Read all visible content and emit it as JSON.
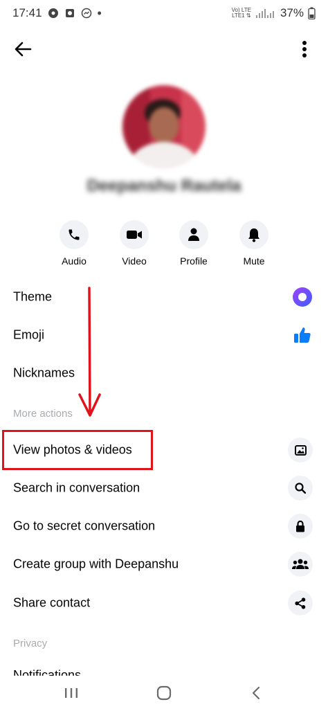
{
  "status_bar": {
    "time": "17:41",
    "network_top": "Vo) LTE",
    "network_bottom": "LTE1 ⇅",
    "battery": "37%"
  },
  "top_bar": {
    "back_icon": "arrow-left-icon",
    "more_icon": "more-vertical-icon"
  },
  "profile": {
    "name": "Deepanshu Rautela"
  },
  "quick_actions": [
    {
      "label": "Audio",
      "icon": "phone-icon"
    },
    {
      "label": "Video",
      "icon": "video-camera-icon"
    },
    {
      "label": "Profile",
      "icon": "person-icon"
    },
    {
      "label": "Mute",
      "icon": "bell-icon"
    }
  ],
  "customization": {
    "theme": "Theme",
    "emoji": "Emoji",
    "nicknames": "Nicknames"
  },
  "more_actions": {
    "header": "More actions",
    "items": [
      {
        "label": "View photos & videos",
        "icon": "image-icon"
      },
      {
        "label": "Search in conversation",
        "icon": "search-icon"
      },
      {
        "label": "Go to secret conversation",
        "icon": "lock-icon"
      },
      {
        "label": "Create group with Deepanshu",
        "icon": "group-icon"
      },
      {
        "label": "Share contact",
        "icon": "share-icon"
      }
    ]
  },
  "privacy": {
    "header": "Privacy",
    "partial_item": "Notifications"
  },
  "colors": {
    "theme_accent": "#7b4bff",
    "emoji_blue": "#0a7cff",
    "annotation_red": "#e0121b"
  }
}
